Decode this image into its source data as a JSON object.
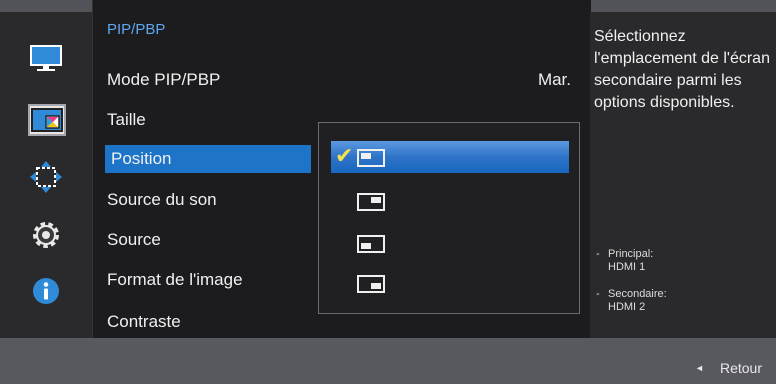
{
  "menu_title": "PIP/PBP",
  "items": [
    {
      "label": "Mode PIP/PBP",
      "value": "Mar."
    },
    {
      "label": "Taille"
    },
    {
      "label": "Position"
    },
    {
      "label": "Source du son"
    },
    {
      "label": "Source"
    },
    {
      "label": "Format de l'image"
    },
    {
      "label": "Contraste"
    }
  ],
  "position_options": [
    "top-left",
    "top-right",
    "bottom-left",
    "bottom-right"
  ],
  "selected_position": "top-left",
  "description": "Sélectionnez l'emplacement de l'écran secondaire parmi les options disponibles.",
  "info": {
    "principal_label": "Principal:",
    "principal_value": "HDMI 1",
    "secondaire_label": "Secondaire:",
    "secondaire_value": "HDMI 2"
  },
  "footer": {
    "back_label": "Retour",
    "back_arrow": "◄"
  },
  "colors": {
    "accent_blue": "#1e74c8",
    "title_blue": "#5fa6ee",
    "check_yellow": "#f4e04d",
    "panel_dark": "#1c1c1f"
  },
  "icons": [
    "monitor-icon",
    "pip-icon",
    "move-arrows-icon",
    "gear-icon",
    "info-icon"
  ]
}
